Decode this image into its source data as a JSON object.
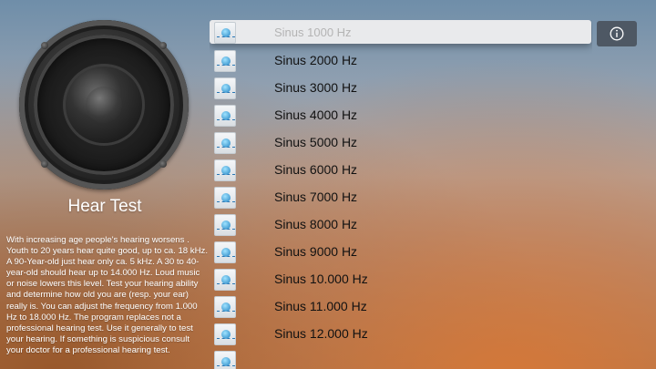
{
  "app": {
    "title": "Hear Test",
    "description": "With increasing age people's hearing worsens . Youth to 20 years hear quite good, up to ca. 18 kHz. A 90-Year-old just hear only ca. 5 kHz. A 30 to 40-year-old should hear up to 14.000 Hz. Loud music or noise lowers this level. Test your hearing ability and determine how old you are (resp. your ear) really is. You can adjust the frequency from 1.000 Hz to 18.000 Hz. The program replaces not a professional hearing test. Use it generally to test your hearing. If something is suspicious consult your doctor for a professional hearing test."
  },
  "info_button": {
    "icon": "info-icon"
  },
  "list": {
    "items": [
      {
        "label": "Sinus 1000 Hz",
        "selected": true
      },
      {
        "label": "Sinus 2000 Hz"
      },
      {
        "label": "Sinus 3000 Hz"
      },
      {
        "label": "Sinus 4000 Hz"
      },
      {
        "label": "Sinus 5000 Hz"
      },
      {
        "label": "Sinus 6000 Hz"
      },
      {
        "label": "Sinus 7000 Hz"
      },
      {
        "label": "Sinus 8000 Hz"
      },
      {
        "label": "Sinus 9000 Hz"
      },
      {
        "label": "Sinus 10.000 Hz"
      },
      {
        "label": "Sinus 11.000 Hz"
      },
      {
        "label": "Sinus 12.000 Hz"
      }
    ]
  }
}
